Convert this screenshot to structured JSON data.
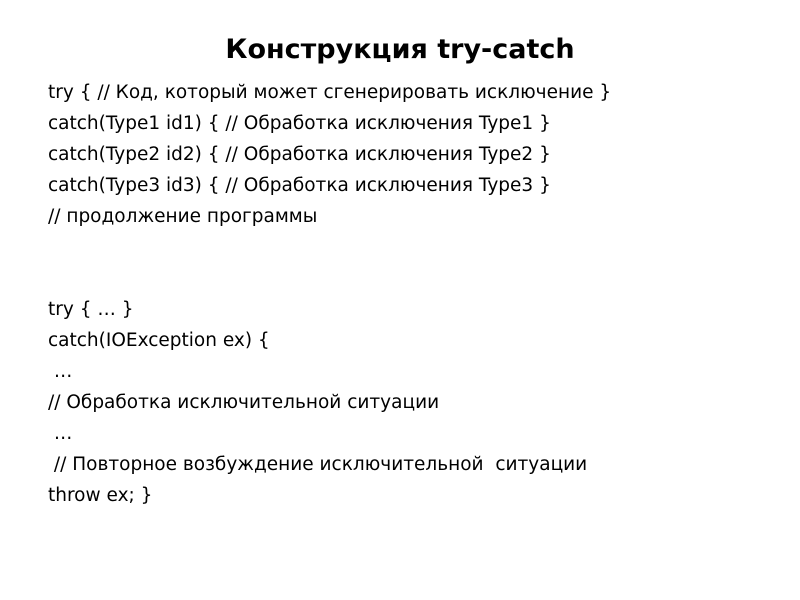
{
  "slide": {
    "title": "Конструкция try-catch",
    "block1": [
      "try { // Код, который может сгенерировать исключение }",
      "catch(Type1 id1) { // Обработка исключения Type1 }",
      "catch(Type2 id2) { // Обработка исключения Type2 }",
      "catch(Type3 id3) { // Обработка исключения Type3 }",
      "// продолжение программы"
    ],
    "block2": [
      "try { … }",
      "catch(IOException ex) {",
      " …",
      "// Обработка исключительной ситуации",
      " …",
      " // Повторное возбуждение исключительной  ситуации",
      "throw ex; }"
    ]
  }
}
